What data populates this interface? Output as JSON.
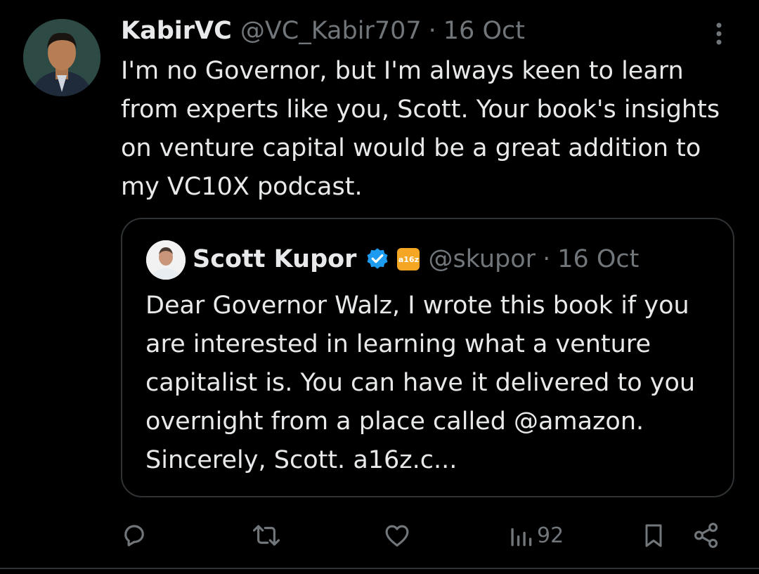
{
  "tweet": {
    "author_name": "KabirVC",
    "author_handle": "@VC_Kabir707",
    "separator": "·",
    "date": "16 Oct",
    "text": "I'm no Governor, but I'm always keen to learn from experts like you, Scott. Your book's insights on venture capital would be a great addition to my VC10X podcast."
  },
  "quoted_tweet": {
    "author_name": "Scott Kupor",
    "affiliation_label": "a16z",
    "author_handle": "@skupor",
    "separator": "·",
    "date": "16 Oct",
    "text": "Dear Governor Walz, I wrote this book if you are interested in learning what a venture capitalist is. You can have it delivered to you overnight from a place called @amazon. Sincerely, Scott. a16z.c..."
  },
  "actions": {
    "views_count": "92"
  },
  "icons": {
    "more": "more-vertical-icon",
    "reply": "reply-icon",
    "retweet": "retweet-icon",
    "like": "heart-icon",
    "views": "views-icon",
    "bookmark": "bookmark-icon",
    "share": "share-icon",
    "verified": "verified-badge-icon"
  },
  "colors": {
    "background": "#000000",
    "text_primary": "#e7e9ea",
    "text_secondary": "#71767b",
    "border": "#2f3336",
    "verified": "#1d9bf0",
    "affiliation": "#f5a623"
  }
}
